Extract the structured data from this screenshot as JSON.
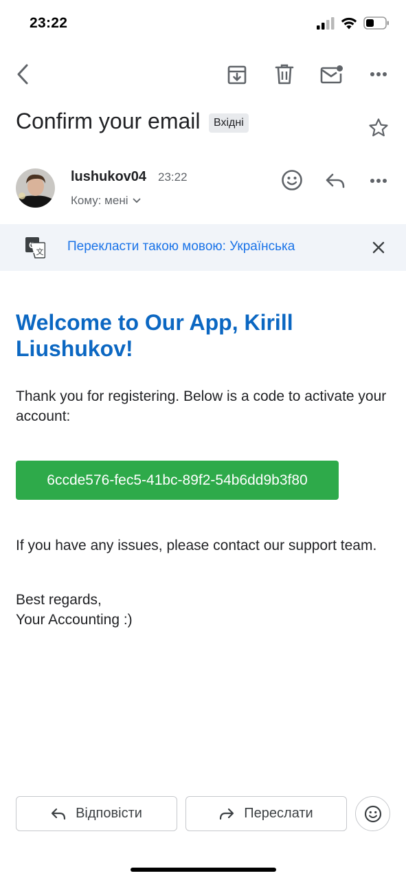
{
  "status_bar": {
    "time": "23:22"
  },
  "email": {
    "subject": "Confirm your email",
    "label": "Вхідні",
    "sender_name": "lushukov04",
    "sent_time": "23:22",
    "recipient": "Кому: мені",
    "translate_prompt": "Перекласти такою мовою: Українська",
    "heading": "Welcome to Our App, Kirill Liushukov!",
    "intro": "Thank you for registering. Below is a code to activate your account:",
    "activation_code": "6ccde576-fec5-41bc-89f2-54b6dd9b3f80",
    "support_text": "If you have any issues, please contact our support team.",
    "closing_line1": "Best regards,",
    "closing_line2": "Your Accounting :)"
  },
  "actions": {
    "reply_label": "Відповісти",
    "forward_label": "Переслати"
  },
  "colors": {
    "accent_blue": "#1a73e8",
    "heading_blue": "#0b67c2",
    "code_green": "#2eaa4a",
    "translate_bg": "#f1f4f9"
  },
  "icons": [
    "back-arrow-icon",
    "archive-icon",
    "trash-icon",
    "mark-unread-icon",
    "more-icon",
    "star-icon",
    "emoji-icon",
    "reply-icon",
    "translate-icon",
    "close-icon",
    "forward-icon"
  ]
}
